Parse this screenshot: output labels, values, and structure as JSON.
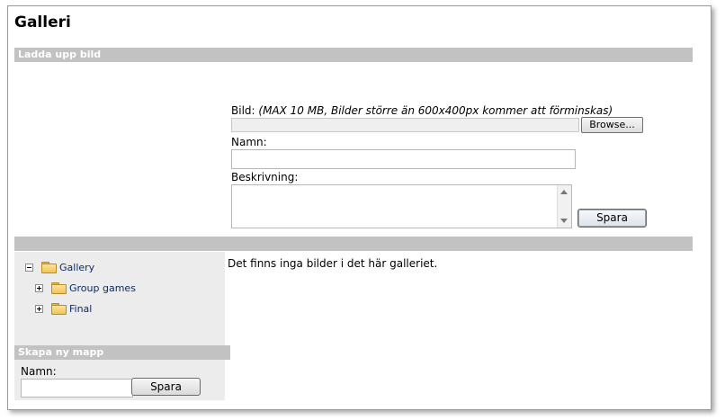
{
  "page": {
    "title": "Galleri"
  },
  "upload": {
    "header": "Ladda upp bild",
    "image_label": "Bild:",
    "image_note": "(MAX 10 MB, Bilder större än 600x400px kommer att förminskas)",
    "browse_label": "Browse...",
    "name_label": "Namn:",
    "name_value": "",
    "description_label": "Beskrivning:",
    "description_value": "",
    "save_label": "Spara"
  },
  "tree": {
    "root": {
      "label": "Gallery",
      "toggle": "minus"
    },
    "children": [
      {
        "label": "Group games",
        "toggle": "plus"
      },
      {
        "label": "Final",
        "toggle": "plus"
      }
    ]
  },
  "gallery": {
    "empty_message": "Det finns inga bilder i det här galleriet."
  },
  "new_folder": {
    "header": "Skapa ny mapp",
    "name_label": "Namn:",
    "name_value": "",
    "save_label": "Spara"
  }
}
